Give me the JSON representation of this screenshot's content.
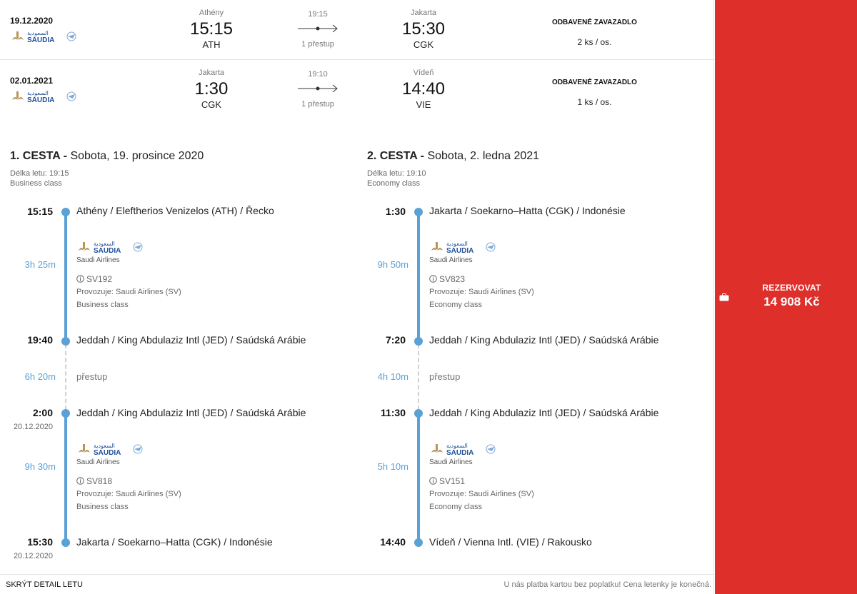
{
  "summary": [
    {
      "date": "19.12.2020",
      "airline_logo": "saudia-logo",
      "dep_city": "Athény",
      "dep_time": "15:15",
      "dep_code": "ATH",
      "duration": "19:15",
      "stops": "1 přestup",
      "arr_city": "Jakarta",
      "arr_time": "15:30",
      "arr_code": "CGK",
      "baggage_title": "ODBAVENÉ ZAVAZADLO",
      "baggage_value": "2 ks / os."
    },
    {
      "date": "02.01.2021",
      "airline_logo": "saudia-logo",
      "dep_city": "Jakarta",
      "dep_time": "1:30",
      "dep_code": "CGK",
      "duration": "19:10",
      "stops": "1 přestup",
      "arr_city": "Vídeň",
      "arr_time": "14:40",
      "arr_code": "VIE",
      "baggage_title": "ODBAVENÉ ZAVAZADLO",
      "baggage_value": "1 ks / os."
    }
  ],
  "journeys": [
    {
      "title_bold": "1. CESTA -",
      "title_rest": " Sobota, 19. prosince 2020",
      "flight_length": "Délka letu: 19:15",
      "cabin": "Business class",
      "segments": [
        {
          "dep_time": "15:15",
          "dep_date": "",
          "dep_place": "Athény / Eleftherios Venizelos (ATH) / Řecko",
          "duration": "3h 25m",
          "airline": "Saudi Airlines",
          "flight": "SV192",
          "operator": "Provozuje: Saudi Airlines (SV)",
          "class": "Business class",
          "arr_time": "19:40",
          "arr_date": "",
          "arr_place": "Jeddah / King Abdulaziz Intl (JED) / Saúdská Arábie"
        },
        {
          "dep_time": "2:00",
          "dep_date": "20.12.2020",
          "dep_place": "Jeddah / King Abdulaziz Intl (JED) / Saúdská Arábie",
          "duration": "9h 30m",
          "airline": "Saudi Airlines",
          "flight": "SV818",
          "operator": "Provozuje: Saudi Airlines (SV)",
          "class": "Business class",
          "arr_time": "15:30",
          "arr_date": "20.12.2020",
          "arr_place": "Jakarta / Soekarno–Hatta (CGK) / Indonésie"
        }
      ],
      "transfer": {
        "duration": "6h 20m",
        "label": "přestup"
      }
    },
    {
      "title_bold": "2. CESTA -",
      "title_rest": " Sobota, 2. ledna 2021",
      "flight_length": "Délka letu: 19:10",
      "cabin": "Economy class",
      "segments": [
        {
          "dep_time": "1:30",
          "dep_date": "",
          "dep_place": "Jakarta / Soekarno–Hatta (CGK) / Indonésie",
          "duration": "9h 50m",
          "airline": "Saudi Airlines",
          "flight": "SV823",
          "operator": "Provozuje: Saudi Airlines (SV)",
          "class": "Economy class",
          "arr_time": "7:20",
          "arr_date": "",
          "arr_place": "Jeddah / King Abdulaziz Intl (JED) / Saúdská Arábie"
        },
        {
          "dep_time": "11:30",
          "dep_date": "",
          "dep_place": "Jeddah / King Abdulaziz Intl (JED) / Saúdská Arábie",
          "duration": "5h 10m",
          "airline": "Saudi Airlines",
          "flight": "SV151",
          "operator": "Provozuje: Saudi Airlines (SV)",
          "class": "Economy class",
          "arr_time": "14:40",
          "arr_date": "",
          "arr_place": "Vídeň / Vienna Intl. (VIE) / Rakousko"
        }
      ],
      "transfer": {
        "duration": "4h 10m",
        "label": "přestup"
      }
    }
  ],
  "booking": {
    "label": "REZERVOVAT",
    "price": "14 908 Kč",
    "icon": "suitcase-icon"
  },
  "footer": {
    "hide_link": "SKRÝT DETAIL LETU",
    "note": "U nás platba kartou bez poplatku! Cena letenky je konečná."
  },
  "colors": {
    "accent": "#de2f2b",
    "timeline": "#5aa1d6",
    "logo_gold": "#b8945a",
    "logo_blue": "#1f4e9a"
  }
}
